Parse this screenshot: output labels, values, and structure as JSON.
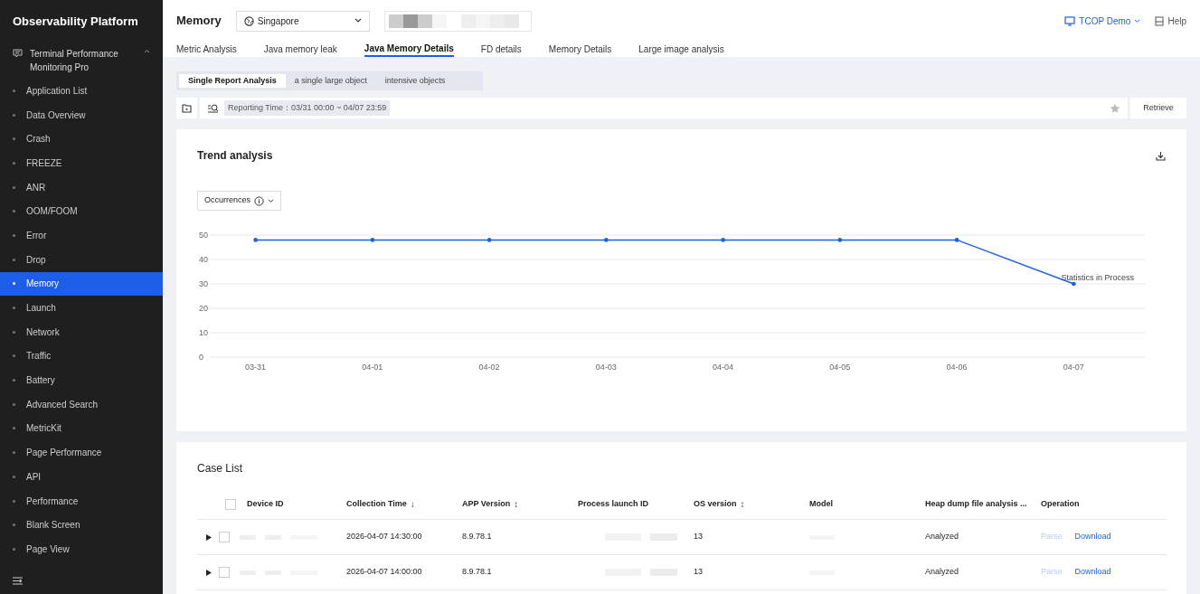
{
  "sidebar": {
    "title": "Observability Platform",
    "group": {
      "label": "Terminal Performance Monitoring Pro",
      "expanded": true
    },
    "items": [
      {
        "label": "Application List",
        "selected": false
      },
      {
        "label": "Data Overview",
        "selected": false
      },
      {
        "label": "Crash",
        "selected": false
      },
      {
        "label": "FREEZE",
        "selected": false
      },
      {
        "label": "ANR",
        "selected": false
      },
      {
        "label": "OOM/FOOM",
        "selected": false
      },
      {
        "label": "Error",
        "selected": false
      },
      {
        "label": "Drop",
        "selected": false
      },
      {
        "label": "Memory",
        "selected": true
      },
      {
        "label": "Launch",
        "selected": false
      },
      {
        "label": "Network",
        "selected": false
      },
      {
        "label": "Traffic",
        "selected": false
      },
      {
        "label": "Battery",
        "selected": false
      },
      {
        "label": "Advanced Search",
        "selected": false
      },
      {
        "label": "MetricKit",
        "selected": false
      },
      {
        "label": "Page Performance",
        "selected": false
      },
      {
        "label": "API",
        "selected": false
      },
      {
        "label": "Performance",
        "selected": false
      },
      {
        "label": "Blank Screen",
        "selected": false
      },
      {
        "label": "Page View",
        "selected": false
      }
    ]
  },
  "header": {
    "title": "Memory",
    "region": "Singapore",
    "account": "TCOP Demo",
    "help": "Help"
  },
  "tabs": [
    {
      "label": "Metric Analysis",
      "selected": false
    },
    {
      "label": "Java memory leak",
      "selected": false
    },
    {
      "label": "Java Memory Details",
      "selected": true
    },
    {
      "label": "FD details",
      "selected": false
    },
    {
      "label": "Memory Details",
      "selected": false
    },
    {
      "label": "Large image analysis",
      "selected": false
    }
  ],
  "subtabs": [
    {
      "label": "Single Report Analysis",
      "selected": true
    },
    {
      "label": "a single large object",
      "selected": false
    },
    {
      "label": "intensive objects",
      "selected": false
    }
  ],
  "filter": {
    "tag": "Reporting Time：03/31 00:00 ~ 04/07 23:59",
    "button": "Retrieve"
  },
  "trend": {
    "title": "Trend analysis",
    "chart_data": {
      "type": "line",
      "grid": true,
      "categories": [
        "03-31",
        "04-01",
        "04-02",
        "04-03",
        "04-04",
        "04-05",
        "04-06",
        "04-07"
      ],
      "series": [
        {
          "name": "Occurrences",
          "color": "#1d5ee8",
          "values": [
            48,
            48,
            48,
            48,
            48,
            48,
            48,
            30
          ]
        }
      ],
      "ylim": [
        0,
        50
      ],
      "yticks": [
        0,
        10,
        20,
        30,
        40,
        50
      ],
      "annotations": [
        "Statistics in Process"
      ]
    }
  },
  "case_list": {
    "title": "Case List",
    "all_checked": false,
    "columns": [
      {
        "label": "Device ID"
      },
      {
        "label": "Collection Time",
        "sort_glyph": "↓"
      },
      {
        "label": "APP Version",
        "sort_glyph": "↕"
      },
      {
        "label": "Process launch ID"
      },
      {
        "label": "OS version",
        "sort_glyph": "↕"
      },
      {
        "label": "Model"
      },
      {
        "label": "Heap dump file analysis ..."
      },
      {
        "label": "Operation"
      }
    ],
    "rows": [
      {
        "checked": false,
        "collection_time": "2026-04-07 14:30:00",
        "app_version": "8.9.78.1",
        "os_version": "13",
        "status": "Analyzed",
        "actions": [
          {
            "label": "Parse",
            "disabled": true
          },
          {
            "label": "Download",
            "disabled": false
          }
        ]
      },
      {
        "checked": false,
        "collection_time": "2026-04-07 14:00:00",
        "app_version": "8.9.78.1",
        "os_version": "13",
        "status": "Analyzed",
        "actions": [
          {
            "label": "Parse",
            "disabled": true
          },
          {
            "label": "Download",
            "disabled": false
          }
        ]
      }
    ]
  }
}
